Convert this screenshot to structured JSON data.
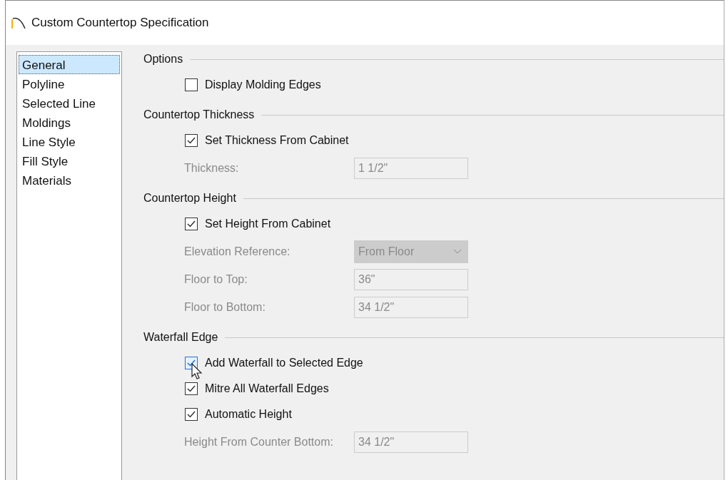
{
  "window": {
    "title": "Custom Countertop Specification"
  },
  "sidebar": {
    "items": [
      {
        "label": "General",
        "selected": true
      },
      {
        "label": "Polyline",
        "selected": false
      },
      {
        "label": "Selected Line",
        "selected": false
      },
      {
        "label": "Moldings",
        "selected": false
      },
      {
        "label": "Line Style",
        "selected": false
      },
      {
        "label": "Fill Style",
        "selected": false
      },
      {
        "label": "Materials",
        "selected": false
      }
    ]
  },
  "sections": [
    {
      "title": "Options",
      "rows": [
        {
          "kind": "checkbox",
          "label": "Display Molding Edges",
          "checked": false,
          "focused": false
        }
      ]
    },
    {
      "title": "Countertop Thickness",
      "rows": [
        {
          "kind": "checkbox",
          "label": "Set Thickness From Cabinet",
          "checked": true,
          "focused": false
        },
        {
          "kind": "field",
          "label": "Thickness:",
          "value": "1 1/2\"",
          "disabled": true
        }
      ]
    },
    {
      "title": "Countertop Height",
      "rows": [
        {
          "kind": "checkbox",
          "label": "Set Height From Cabinet",
          "checked": true,
          "focused": false
        },
        {
          "kind": "select",
          "label": "Elevation Reference:",
          "value": "From Floor",
          "disabled": true
        },
        {
          "kind": "field",
          "label": "Floor to Top:",
          "value": "36\"",
          "disabled": true
        },
        {
          "kind": "field",
          "label": "Floor to Bottom:",
          "value": "34 1/2\"",
          "disabled": true
        }
      ]
    },
    {
      "title": "Waterfall Edge",
      "rows": [
        {
          "kind": "checkbox",
          "label": "Add Waterfall to Selected Edge",
          "checked": true,
          "focused": true
        },
        {
          "kind": "checkbox",
          "label": "Mitre All Waterfall Edges",
          "checked": true,
          "focused": false
        },
        {
          "kind": "checkbox",
          "label": "Automatic Height",
          "checked": true,
          "focused": false
        },
        {
          "kind": "field",
          "label": "Height From Counter Bottom:",
          "value": "34 1/2\"",
          "disabled": true
        }
      ]
    }
  ]
}
